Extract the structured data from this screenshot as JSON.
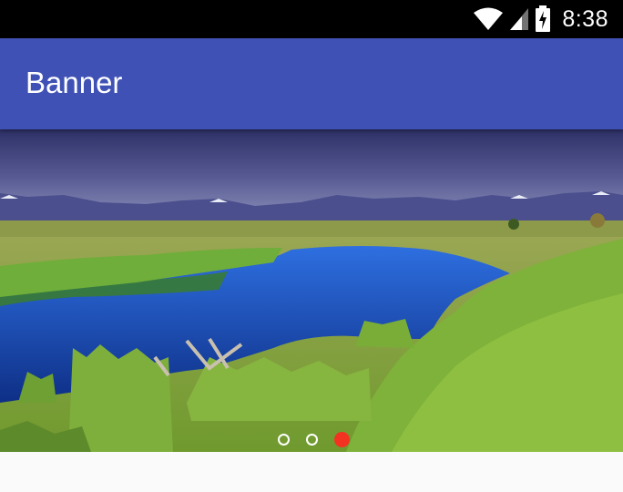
{
  "status_bar": {
    "time": "8:38",
    "icons": [
      "wifi-icon",
      "cell-signal-icon",
      "battery-charging-icon"
    ]
  },
  "app_bar": {
    "title": "Banner",
    "color": "#3f51b5"
  },
  "banner": {
    "image": "landscape-river-meadow-mountains",
    "page_count": 3,
    "current_page": 3,
    "indicator_active_color": "#f43221",
    "indicator_inactive_color": "#ffffff"
  }
}
